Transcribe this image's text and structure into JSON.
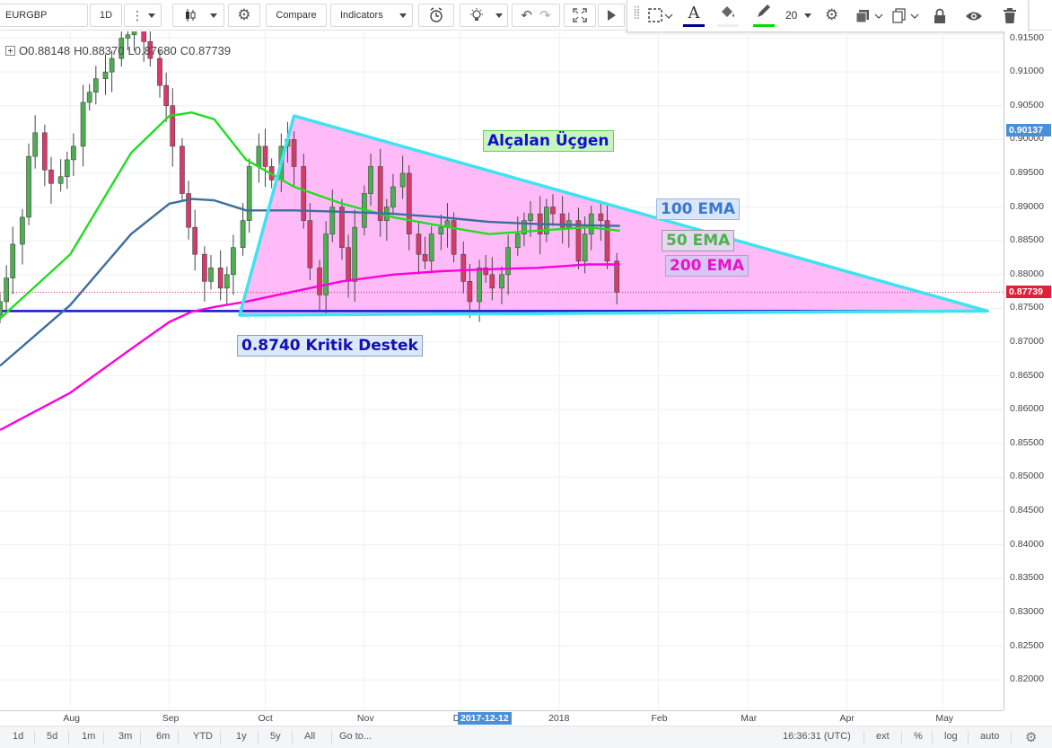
{
  "toolbar": {
    "symbol": "EURGBP",
    "interval": "1D",
    "compare_label": "Compare",
    "indicators_label": "Indicators"
  },
  "draw_toolbar": {
    "font_size": "20",
    "text_color": "#00008b",
    "line_color": "#00dd00"
  },
  "legend": {
    "open": "O0.88148",
    "high": "H0.88370",
    "low": "L0.87680",
    "close": "C0.87739"
  },
  "price_axis": {
    "labels": [
      "0.91500",
      "0.91000",
      "0.90500",
      "0.90000",
      "0.89500",
      "0.89000",
      "0.88500",
      "0.88000",
      "0.87500",
      "0.87000",
      "0.86500",
      "0.86000",
      "0.85500",
      "0.85000",
      "0.84500",
      "0.84000",
      "0.83500",
      "0.83000",
      "0.82500",
      "0.82000"
    ],
    "values": [
      0.915,
      0.91,
      0.905,
      0.9,
      0.895,
      0.89,
      0.885,
      0.88,
      0.875,
      0.87,
      0.865,
      0.86,
      0.855,
      0.85,
      0.845,
      0.84,
      0.835,
      0.83,
      0.825,
      0.82
    ],
    "tag_current": "0.87739",
    "tag_current_color": "#e0203a",
    "tag_marker": "0.90137",
    "tag_marker_color": "#4a90d9"
  },
  "time_axis": {
    "labels": [
      "Aug",
      "Sep",
      "Oct",
      "Nov",
      "De",
      "2018",
      "Feb",
      "Mar",
      "Apr",
      "May"
    ],
    "cursor_date": "2017-12-12"
  },
  "annotations": {
    "title": "Alçalan Üçgen",
    "ema100": "100 EMA",
    "ema50": "50 EMA",
    "ema200": "200 EMA",
    "support": "0.8740 Kritik Destek"
  },
  "colors": {
    "up_candle": "#4caf50",
    "down_candle": "#d83a6a",
    "ema50": "#22dd22",
    "ema100": "#3c6e9e",
    "ema200": "#ff00dd",
    "triangle_stroke": "#3ee3f0",
    "triangle_fill": "#ffaaf5",
    "support_line": "#1515c8"
  },
  "bottom_bar": {
    "ranges": [
      "1d",
      "5d",
      "1m",
      "3m",
      "6m",
      "YTD",
      "1y",
      "5y",
      "All"
    ],
    "goto_label": "Go to...",
    "clock": "16:36:31 (UTC)",
    "options": [
      "ext",
      "%",
      "log",
      "auto"
    ]
  },
  "chart_data": {
    "type": "candlestick",
    "symbol": "EURGBP",
    "interval": "1D",
    "y_range": [
      0.8155,
      0.916
    ],
    "x_range": [
      "2017-07-10",
      "2018-05-20"
    ],
    "tick_labels_y": [
      "0.91500",
      "0.91000",
      "0.90500",
      "0.90000",
      "0.89500",
      "0.89000",
      "0.88500",
      "0.88000",
      "0.87500",
      "0.87000",
      "0.86500",
      "0.86000",
      "0.85500",
      "0.85000",
      "0.84500",
      "0.84000",
      "0.83500",
      "0.83000",
      "0.82500",
      "0.82000"
    ],
    "tick_labels_x": [
      "Aug",
      "Sep",
      "Oct",
      "Nov",
      "De",
      "2018",
      "Feb",
      "Mar",
      "Apr",
      "May"
    ],
    "candles_close_approx": [
      0.876,
      0.8795,
      0.8845,
      0.8885,
      0.8975,
      0.901,
      0.8955,
      0.8935,
      0.8945,
      0.897,
      0.899,
      0.9055,
      0.907,
      0.909,
      0.91,
      0.912,
      0.915,
      0.9155,
      0.9165,
      0.9145,
      0.912,
      0.908,
      0.905,
      0.899,
      0.892,
      0.887,
      0.883,
      0.879,
      0.881,
      0.878,
      0.88,
      0.884,
      0.888,
      0.896,
      0.899,
      0.896,
      0.894,
      0.899,
      0.9,
      0.896,
      0.888,
      0.881,
      0.877,
      0.886,
      0.89,
      0.884,
      0.879,
      0.887,
      0.892,
      0.896,
      0.888,
      0.89,
      0.893,
      0.895,
      0.886,
      0.883,
      0.882,
      0.886,
      0.887,
      0.888,
      0.883,
      0.879,
      0.876,
      0.881,
      0.88,
      0.878,
      0.88,
      0.884,
      0.886,
      0.888,
      0.889,
      0.886,
      0.89,
      0.889,
      0.887,
      0.888,
      0.882,
      0.886,
      0.889,
      0.888,
      0.882,
      0.8774
    ],
    "ema_series": [
      {
        "name": "50 EMA",
        "x": [
          "2017-07-10",
          "2017-08-01",
          "2017-08-20",
          "2017-09-01",
          "2017-09-08",
          "2017-09-15",
          "2017-09-25",
          "2017-10-10",
          "2017-10-25",
          "2017-11-10",
          "2017-11-25",
          "2017-12-10",
          "2017-12-25",
          "2018-01-10",
          "2018-01-20"
        ],
        "values": [
          0.8735,
          0.883,
          0.898,
          0.9035,
          0.904,
          0.903,
          0.897,
          0.893,
          0.8905,
          0.8885,
          0.8872,
          0.886,
          0.8865,
          0.887,
          0.8865
        ]
      },
      {
        "name": "100 EMA",
        "x": [
          "2017-07-10",
          "2017-08-01",
          "2017-08-20",
          "2017-09-01",
          "2017-09-08",
          "2017-09-15",
          "2017-09-25",
          "2017-10-10",
          "2017-10-25",
          "2017-11-10",
          "2017-11-25",
          "2017-12-10",
          "2017-12-25",
          "2018-01-10",
          "2018-01-20"
        ],
        "values": [
          0.8665,
          0.8755,
          0.886,
          0.8905,
          0.8912,
          0.891,
          0.8895,
          0.8895,
          0.8893,
          0.889,
          0.8885,
          0.8878,
          0.8875,
          0.8873,
          0.8872
        ]
      },
      {
        "name": "200 EMA",
        "x": [
          "2017-07-10",
          "2017-08-01",
          "2017-08-20",
          "2017-09-01",
          "2017-09-08",
          "2017-09-15",
          "2017-09-25",
          "2017-10-10",
          "2017-10-25",
          "2017-11-10",
          "2017-11-25",
          "2017-12-10",
          "2017-12-25",
          "2018-01-10",
          "2018-01-20"
        ],
        "values": [
          0.857,
          0.8625,
          0.869,
          0.873,
          0.8745,
          0.8752,
          0.876,
          0.8775,
          0.879,
          0.88,
          0.8805,
          0.8808,
          0.881,
          0.8815,
          0.8815
        ]
      }
    ],
    "drawings": {
      "triangle": [
        {
          "x": "2017-09-23",
          "y": 0.874
        },
        {
          "x": "2017-10-10",
          "y": 0.9035
        },
        {
          "x": "2018-05-15",
          "y": 0.8746
        }
      ],
      "support_level": 0.8746,
      "current_price_line": 0.87739
    }
  }
}
